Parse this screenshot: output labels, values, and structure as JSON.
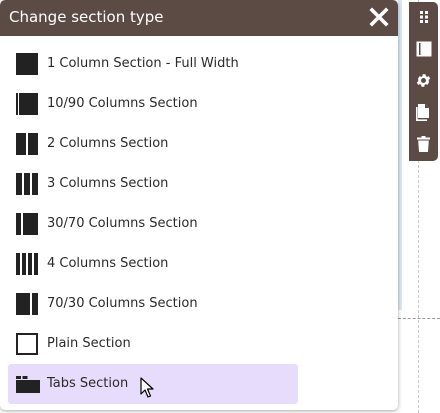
{
  "popup": {
    "title": "Change section type",
    "close_icon": "close-icon"
  },
  "sections": [
    {
      "label": "1 Column Section - Full Width",
      "icon": "section-1-column-full-width-icon"
    },
    {
      "label": "10/90 Columns Section",
      "icon": "section-10-90-icon"
    },
    {
      "label": "2 Columns Section",
      "icon": "section-2-columns-icon"
    },
    {
      "label": "3 Columns Section",
      "icon": "section-3-columns-icon"
    },
    {
      "label": "30/70 Columns Section",
      "icon": "section-30-70-icon"
    },
    {
      "label": "4 Columns Section",
      "icon": "section-4-columns-icon"
    },
    {
      "label": "70/30 Columns Section",
      "icon": "section-70-30-icon"
    },
    {
      "label": "Plain Section",
      "icon": "section-plain-icon"
    },
    {
      "label": "Tabs Section",
      "icon": "section-tabs-icon"
    }
  ],
  "selected_index": 8,
  "toolbar": {
    "items": [
      "drag-handle-icon",
      "section-layout-icon",
      "gear-icon",
      "copy-icon",
      "trash-icon"
    ]
  },
  "colors": {
    "header_bg": "#5c4a45",
    "selected_bg": "#e8dcfc",
    "icon_fill": "#222222"
  }
}
